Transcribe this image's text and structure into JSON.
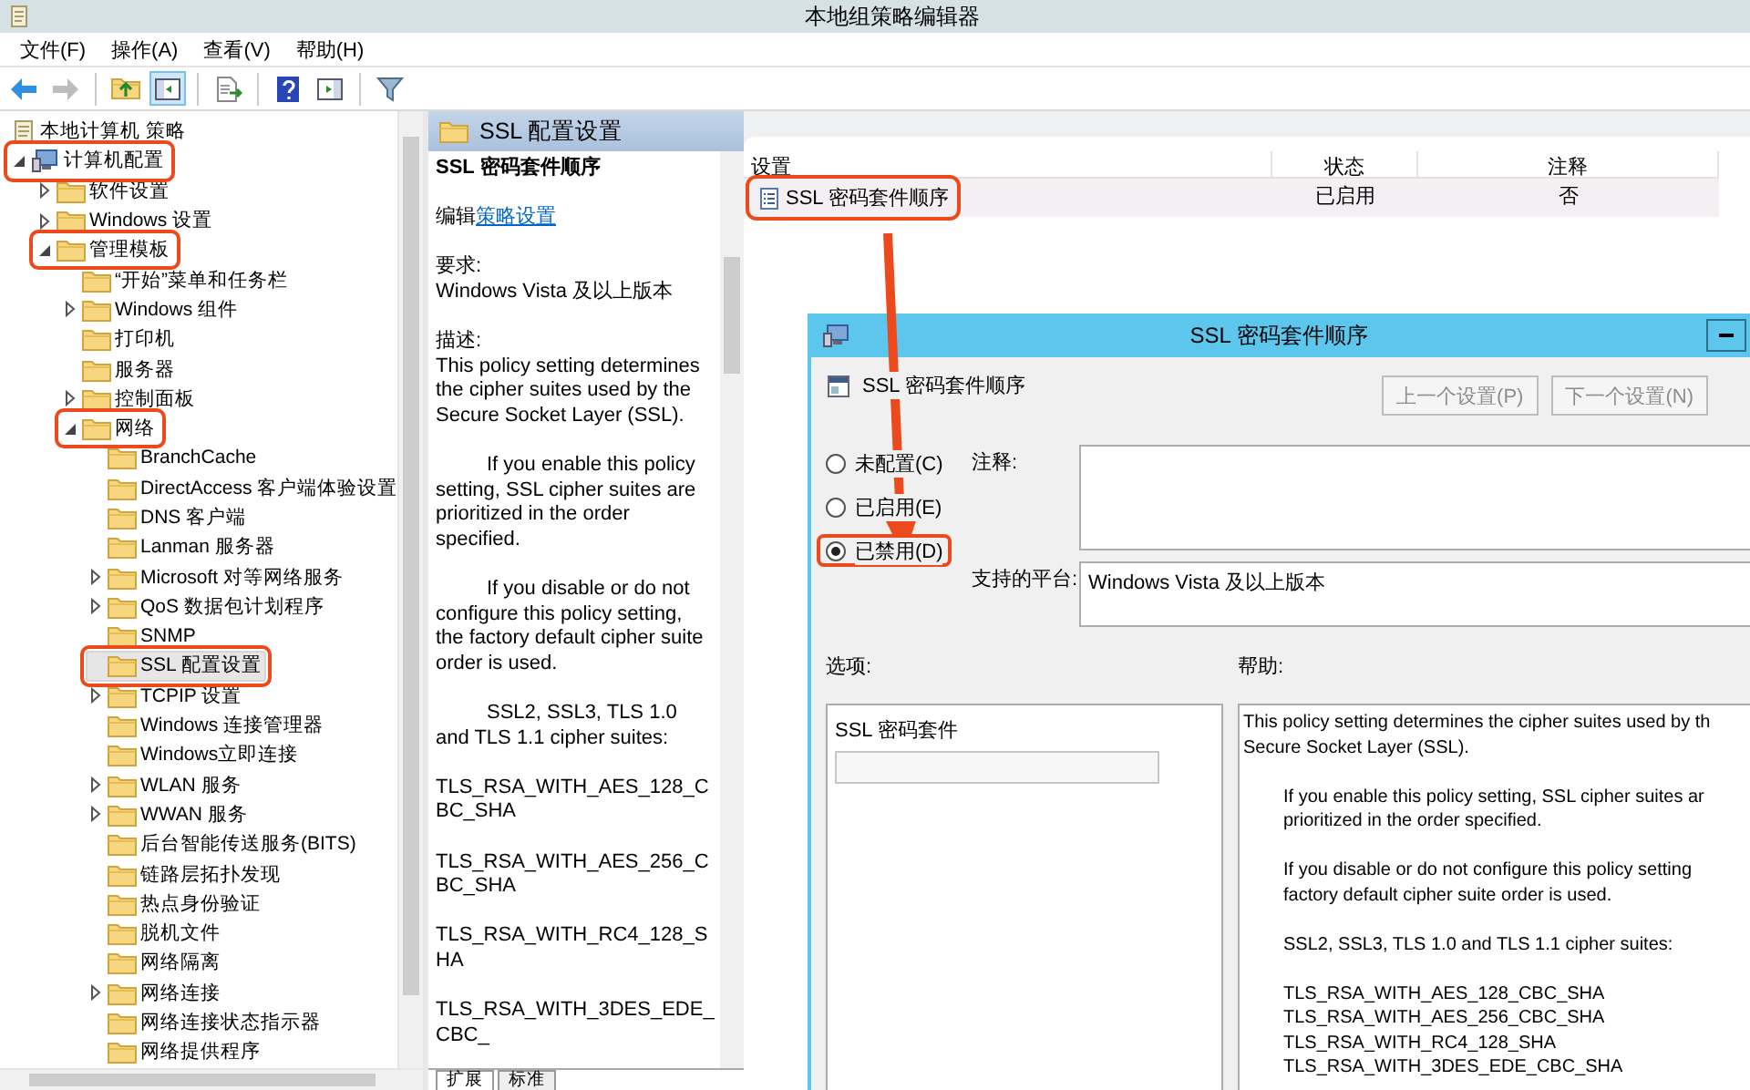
{
  "window": {
    "title": "本地组策略编辑器"
  },
  "menu": [
    "文件(F)",
    "操作(A)",
    "查看(V)",
    "帮助(H)"
  ],
  "toolbar": [
    {
      "kind": "back",
      "disabled": false,
      "pressed": false
    },
    {
      "kind": "forward",
      "disabled": true,
      "pressed": false
    },
    {
      "kind": "up",
      "disabled": false,
      "pressed": false
    },
    {
      "kind": "tree",
      "disabled": false,
      "pressed": true
    },
    {
      "kind": "export",
      "disabled": false,
      "pressed": false
    },
    {
      "kind": "help",
      "disabled": false,
      "pressed": false
    },
    {
      "kind": "view",
      "disabled": false,
      "pressed": false
    },
    {
      "kind": "filter",
      "disabled": false,
      "pressed": false
    }
  ],
  "tree": [
    {
      "label": "本地计算机 策略",
      "kind": "policy",
      "selected": false,
      "annotated": false,
      "children": [
        {
          "label": "计算机配置",
          "kind": "computer",
          "expanded": true,
          "selected": false,
          "annotated": true,
          "children": [
            {
              "label": "软件设置",
              "kind": "folder",
              "expanded": false,
              "selected": false,
              "annotated": false
            },
            {
              "label": "Windows 设置",
              "kind": "folder",
              "expanded": false,
              "selected": false,
              "annotated": false
            },
            {
              "label": "管理模板",
              "kind": "folder",
              "expanded": true,
              "selected": false,
              "annotated": true,
              "children": [
                {
                  "label": "“开始”菜单和任务栏",
                  "kind": "folder",
                  "selected": false,
                  "annotated": false
                },
                {
                  "label": "Windows 组件",
                  "kind": "folder",
                  "expanded": false,
                  "selected": false,
                  "annotated": false
                },
                {
                  "label": "打印机",
                  "kind": "folder",
                  "selected": false,
                  "annotated": false
                },
                {
                  "label": "服务器",
                  "kind": "folder",
                  "selected": false,
                  "annotated": false
                },
                {
                  "label": "控制面板",
                  "kind": "folder",
                  "expanded": false,
                  "selected": false,
                  "annotated": false
                },
                {
                  "label": "网络",
                  "kind": "folder",
                  "expanded": true,
                  "selected": false,
                  "annotated": true,
                  "children": [
                    {
                      "label": "BranchCache",
                      "kind": "folder",
                      "selected": false,
                      "annotated": false
                    },
                    {
                      "label": "DirectAccess 客户端体验设置",
                      "kind": "folder",
                      "selected": false,
                      "annotated": false
                    },
                    {
                      "label": "DNS 客户端",
                      "kind": "folder",
                      "selected": false,
                      "annotated": false
                    },
                    {
                      "label": "Lanman 服务器",
                      "kind": "folder",
                      "selected": false,
                      "annotated": false
                    },
                    {
                      "label": "Microsoft 对等网络服务",
                      "kind": "folder",
                      "expanded": false,
                      "selected": false,
                      "annotated": false
                    },
                    {
                      "label": "QoS 数据包计划程序",
                      "kind": "folder",
                      "expanded": false,
                      "selected": false,
                      "annotated": false
                    },
                    {
                      "label": "SNMP",
                      "kind": "folder",
                      "selected": false,
                      "annotated": false
                    },
                    {
                      "label": "SSL 配置设置",
                      "kind": "folder",
                      "selected": true,
                      "annotated": true
                    },
                    {
                      "label": "TCPIP 设置",
                      "kind": "folder",
                      "expanded": false,
                      "selected": false,
                      "annotated": false
                    },
                    {
                      "label": "Windows 连接管理器",
                      "kind": "folder",
                      "selected": false,
                      "annotated": false
                    },
                    {
                      "label": "Windows立即连接",
                      "kind": "folder",
                      "selected": false,
                      "annotated": false
                    },
                    {
                      "label": "WLAN 服务",
                      "kind": "folder",
                      "expanded": false,
                      "selected": false,
                      "annotated": false
                    },
                    {
                      "label": "WWAN 服务",
                      "kind": "folder",
                      "expanded": false,
                      "selected": false,
                      "annotated": false
                    },
                    {
                      "label": "后台智能传送服务(BITS)",
                      "kind": "folder",
                      "selected": false,
                      "annotated": false
                    },
                    {
                      "label": "链路层拓扑发现",
                      "kind": "folder",
                      "selected": false,
                      "annotated": false
                    },
                    {
                      "label": "热点身份验证",
                      "kind": "folder",
                      "selected": false,
                      "annotated": false
                    },
                    {
                      "label": "脱机文件",
                      "kind": "folder",
                      "selected": false,
                      "annotated": false
                    },
                    {
                      "label": "网络隔离",
                      "kind": "folder",
                      "selected": false,
                      "annotated": false
                    },
                    {
                      "label": "网络连接",
                      "kind": "folder",
                      "expanded": false,
                      "selected": false,
                      "annotated": false
                    },
                    {
                      "label": "网络连接状态指示器",
                      "kind": "folder",
                      "selected": false,
                      "annotated": false
                    },
                    {
                      "label": "网络提供程序",
                      "kind": "folder",
                      "selected": false,
                      "annotated": false
                    }
                  ]
                }
              ]
            }
          ]
        }
      ]
    }
  ],
  "description": {
    "header": "SSL 配置设置",
    "title": "SSL 密码套件顺序",
    "edit_prefix": "编辑",
    "edit_link": "策略设置",
    "requirements_label": "要求:",
    "requirements": "Windows Vista 及以上版本",
    "description_label": "描述:",
    "paragraphs": [
      {
        "indent": false,
        "text": "This policy setting determines the cipher suites used by the Secure Socket Layer (SSL)."
      },
      {
        "indent": true,
        "text": "If you enable this policy setting, SSL cipher suites are prioritized in the order specified."
      },
      {
        "indent": true,
        "text": "If you disable or do not configure this policy setting, the factory default cipher suite order is used."
      },
      {
        "indent": true,
        "text": "SSL2, SSL3, TLS 1.0 and TLS 1.1 cipher suites:"
      }
    ],
    "ciphers": [
      "TLS_RSA_WITH_AES_128_CBC_SHA",
      "TLS_RSA_WITH_AES_256_CBC_SHA",
      "TLS_RSA_WITH_RC4_128_SHA",
      "TLS_RSA_WITH_3DES_EDE_CBC_"
    ],
    "tabs": [
      {
        "label": "扩展",
        "selected": true
      },
      {
        "label": "标准",
        "selected": false
      }
    ]
  },
  "list": {
    "columns": [
      "设置",
      "状态",
      "注释"
    ],
    "rows": [
      {
        "cells": [
          "SSL 密码套件顺序",
          "已启用",
          "否"
        ],
        "selected": true,
        "annotated": true
      }
    ]
  },
  "dialog": {
    "title": "SSL 密码套件顺序",
    "policy_name": "SSL 密码套件顺序",
    "buttons": [
      {
        "label": "上一个设置(P)",
        "disabled": true
      },
      {
        "label": "下一个设置(N)",
        "disabled": true
      }
    ],
    "radios": [
      {
        "label": "未配置(C)",
        "selected": false,
        "annotated": false
      },
      {
        "label": "已启用(E)",
        "selected": false,
        "annotated": false
      },
      {
        "label": "已禁用(D)",
        "selected": true,
        "annotated": true
      }
    ],
    "comment_label": "注释:",
    "platform_label": "支持的平台:",
    "platform": "Windows Vista 及以上版本",
    "options_label": "选项:",
    "help_label": "帮助:",
    "options": [
      {
        "kind": "textbox",
        "label": "SSL 密码套件"
      }
    ],
    "help": [
      {
        "indent": false,
        "lines": [
          "This policy setting determines the cipher suites used by th",
          "Secure Socket Layer (SSL)."
        ]
      },
      {
        "indent": true,
        "lines": [
          "If you enable this policy setting, SSL cipher suites ar",
          "prioritized in the order specified."
        ]
      },
      {
        "indent": true,
        "lines": [
          "If you disable or do not configure this policy setting",
          "factory default cipher suite order is used."
        ]
      },
      {
        "indent": true,
        "lines": [
          "SSL2, SSL3, TLS 1.0 and TLS 1.1 cipher suites:"
        ]
      },
      {
        "indent": true,
        "lines": [
          "TLS_RSA_WITH_AES_128_CBC_SHA",
          "TLS_RSA_WITH_AES_256_CBC_SHA",
          "TLS_RSA_WITH_RC4_128_SHA",
          "TLS_RSA_WITH_3DES_EDE_CBC_SHA"
        ]
      }
    ]
  }
}
